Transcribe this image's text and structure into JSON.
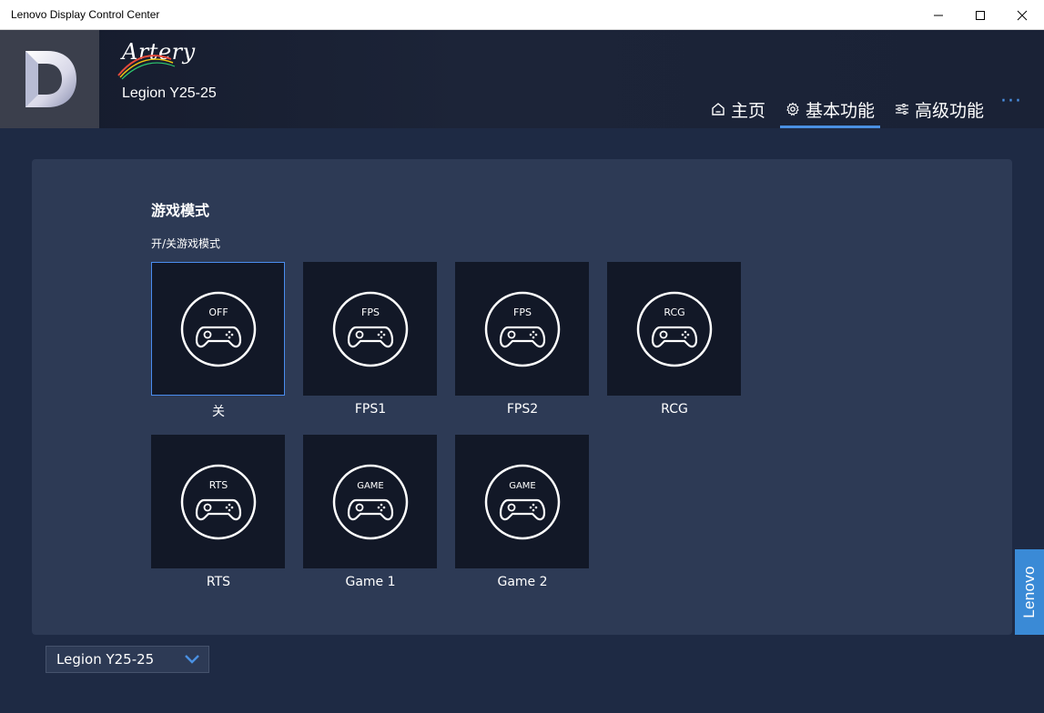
{
  "window": {
    "title": "Lenovo Display Control Center"
  },
  "brand": {
    "name": "Artery",
    "model": "Legion Y25-25",
    "logo_letter": "D"
  },
  "nav": {
    "items": [
      {
        "label": "主页",
        "icon": "home-icon",
        "active": false
      },
      {
        "label": "基本功能",
        "icon": "gear-icon",
        "active": true
      },
      {
        "label": "高级功能",
        "icon": "sliders-icon",
        "active": false
      }
    ],
    "more": "···"
  },
  "game_mode": {
    "title": "游戏模式",
    "subtitle": "开/关游戏模式",
    "modes": [
      {
        "badge": "OFF",
        "label": "关",
        "selected": true
      },
      {
        "badge": "FPS",
        "label": "FPS1",
        "selected": false
      },
      {
        "badge": "FPS",
        "label": "FPS2",
        "selected": false
      },
      {
        "badge": "RCG",
        "label": "RCG",
        "selected": false
      },
      {
        "badge": "RTS",
        "label": "RTS",
        "selected": false
      },
      {
        "badge": "GAME",
        "label": "Game 1",
        "selected": false
      },
      {
        "badge": "GAME",
        "label": "Game 2",
        "selected": false
      }
    ]
  },
  "monitor_select": {
    "value": "Legion Y25-25"
  },
  "lenovo_badge": "Lenovo",
  "colors": {
    "accent": "#4a90e2",
    "panel": "#2d3a55",
    "background": "#1e2a44",
    "tile": "#121827"
  }
}
